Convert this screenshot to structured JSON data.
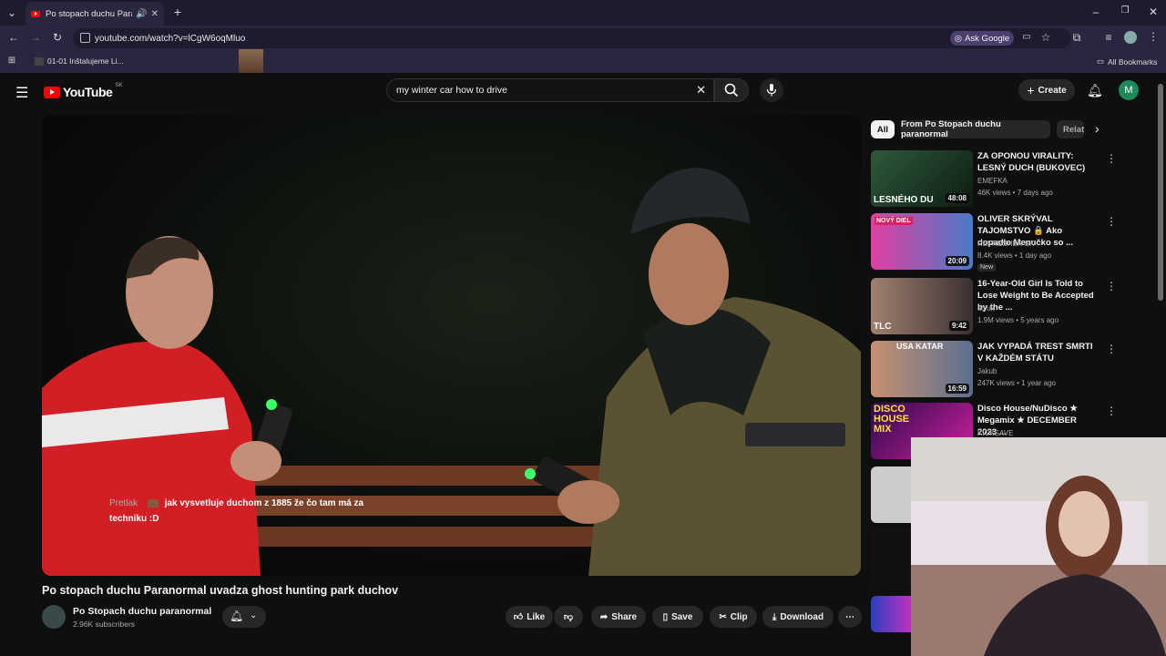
{
  "browser": {
    "tab_title": "Po stopach duchu Paranormal",
    "url": "youtube.com/watch?v=lCgW6oqMluo",
    "ask_google": "Ask Google",
    "bookmark_1": "01-01 Inštalujeme Li...",
    "all_bookmarks": "All Bookmarks"
  },
  "youtube": {
    "logo_text": "YouTube",
    "country_code": "SK",
    "search_query": "my winter car how to drive",
    "create_label": "Create",
    "avatar_letter": "M"
  },
  "video": {
    "title": "Po stopach duchu Paranormal uvadza ghost hunting park duchov",
    "chat_author": "Pretlak",
    "chat_message": "jak vysvetluje duchom z 1885 že čo tam má za techniku :D",
    "channel_name": "Po Stopach duchu paranormal",
    "subscribers": "2.96K subscribers",
    "actions": {
      "like": "Like",
      "share": "Share",
      "save": "Save",
      "clip": "Clip",
      "download": "Download"
    }
  },
  "chips": [
    "All",
    "From Po Stopach duchu paranormal",
    "Relat"
  ],
  "recommendations": [
    {
      "title": "ZA OPONOU VIRALITY: LESNÝ DUCH (BUKOVEC)",
      "channel": "EMEFKA",
      "meta": "46K views • 7 days ago",
      "duration": "48:08",
      "thumb_text": "LESNÉHO DU"
    },
    {
      "title": "OLIVER SKRÝVAL TAJOMSTVO 🔒 Ako dopadlo Menučko so ...",
      "channel": "REFRESHER SK",
      "meta": "8.4K views • 1 day ago",
      "duration": "20:09",
      "badge": "New",
      "thumb_text": "NOVÝ DIEL"
    },
    {
      "title": "16-Year-Old Girl Is Told to Lose Weight to Be Accepted by the ...",
      "channel": "tlc uk",
      "meta": "1.9M views • 5 years ago",
      "duration": "9:42",
      "thumb_text": "TLC"
    },
    {
      "title": "JAK VYPADÁ TREST SMRTI V KAŽDÉM STÁTU",
      "channel": "Jakub",
      "meta": "247K views • 1 year ago",
      "duration": "16:59",
      "thumb_text": "USA KATAR"
    },
    {
      "title": "Disco House/NuDisco ★ Megamix ★ DECEMBER 2023 ...",
      "channel": "KICKSAVE",
      "meta": "",
      "duration": "",
      "thumb_text": "DISCO HOUSE MIX"
    }
  ]
}
